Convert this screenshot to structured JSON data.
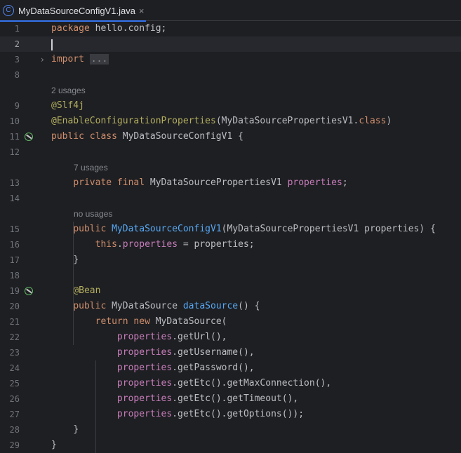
{
  "tab": {
    "title": "MyDataSourceConfigV1.java",
    "icon": "class-c-icon",
    "close": "×"
  },
  "lines": [
    {
      "n": "1",
      "tokens": [
        {
          "t": "kw",
          "v": "package"
        },
        {
          "t": "p",
          "v": " hello.config;"
        }
      ]
    },
    {
      "n": "2",
      "tokens": [],
      "current": true
    },
    {
      "n": "3",
      "tokens": [
        {
          "t": "kw",
          "v": "import"
        },
        {
          "t": "p",
          "v": " "
        },
        {
          "t": "fold",
          "v": "..."
        }
      ],
      "fold": true
    },
    {
      "n": "8",
      "tokens": []
    },
    {
      "hint": "2 usages"
    },
    {
      "n": "9",
      "tokens": [
        {
          "t": "ann",
          "v": "@Slf4j"
        }
      ]
    },
    {
      "n": "10",
      "tokens": [
        {
          "t": "ann",
          "v": "@EnableConfigurationProperties"
        },
        {
          "t": "p",
          "v": "(MyDataSourcePropertiesV1."
        },
        {
          "t": "kw",
          "v": "class"
        },
        {
          "t": "p",
          "v": ")"
        }
      ]
    },
    {
      "n": "11",
      "tokens": [
        {
          "t": "kw",
          "v": "public class"
        },
        {
          "t": "p",
          "v": " MyDataSourceConfigV1 {"
        }
      ],
      "gutter": "bean-icon"
    },
    {
      "n": "12",
      "tokens": []
    },
    {
      "hint": "7 usages",
      "indent": 1
    },
    {
      "n": "13",
      "tokens": [
        {
          "t": "i",
          "v": "    "
        },
        {
          "t": "kw",
          "v": "private final"
        },
        {
          "t": "p",
          "v": " MyDataSourcePropertiesV1 "
        },
        {
          "t": "fld",
          "v": "properties"
        },
        {
          "t": "p",
          "v": ";"
        }
      ]
    },
    {
      "n": "14",
      "tokens": []
    },
    {
      "hint": "no usages",
      "indent": 1
    },
    {
      "n": "15",
      "tokens": [
        {
          "t": "i",
          "v": "    "
        },
        {
          "t": "kw",
          "v": "public"
        },
        {
          "t": "p",
          "v": " "
        },
        {
          "t": "fn",
          "v": "MyDataSourceConfigV1"
        },
        {
          "t": "p",
          "v": "(MyDataSourcePropertiesV1 properties) {"
        }
      ]
    },
    {
      "n": "16",
      "tokens": [
        {
          "t": "i",
          "v": "        "
        },
        {
          "t": "kw",
          "v": "this"
        },
        {
          "t": "p",
          "v": "."
        },
        {
          "t": "fld",
          "v": "properties"
        },
        {
          "t": "p",
          "v": " = properties;"
        }
      ]
    },
    {
      "n": "17",
      "tokens": [
        {
          "t": "i",
          "v": "    "
        },
        {
          "t": "p",
          "v": "}"
        }
      ]
    },
    {
      "n": "18",
      "tokens": []
    },
    {
      "n": "19",
      "tokens": [
        {
          "t": "i",
          "v": "    "
        },
        {
          "t": "ann",
          "v": "@Bean"
        }
      ],
      "gutter": "bean-method-icon"
    },
    {
      "n": "20",
      "tokens": [
        {
          "t": "i",
          "v": "    "
        },
        {
          "t": "kw",
          "v": "public"
        },
        {
          "t": "p",
          "v": " MyDataSource "
        },
        {
          "t": "fn",
          "v": "dataSource"
        },
        {
          "t": "p",
          "v": "() {"
        }
      ]
    },
    {
      "n": "21",
      "tokens": [
        {
          "t": "i",
          "v": "        "
        },
        {
          "t": "kw",
          "v": "return new"
        },
        {
          "t": "p",
          "v": " MyDataSource("
        }
      ]
    },
    {
      "n": "22",
      "tokens": [
        {
          "t": "i",
          "v": "            "
        },
        {
          "t": "fld",
          "v": "properties"
        },
        {
          "t": "p",
          "v": ".getUrl(),"
        }
      ]
    },
    {
      "n": "23",
      "tokens": [
        {
          "t": "i",
          "v": "            "
        },
        {
          "t": "fld",
          "v": "properties"
        },
        {
          "t": "p",
          "v": ".getUsername(),"
        }
      ]
    },
    {
      "n": "24",
      "tokens": [
        {
          "t": "i",
          "v": "            "
        },
        {
          "t": "fld",
          "v": "properties"
        },
        {
          "t": "p",
          "v": ".getPassword(),"
        }
      ]
    },
    {
      "n": "25",
      "tokens": [
        {
          "t": "i",
          "v": "            "
        },
        {
          "t": "fld",
          "v": "properties"
        },
        {
          "t": "p",
          "v": ".getEtc().getMaxConnection(),"
        }
      ]
    },
    {
      "n": "26",
      "tokens": [
        {
          "t": "i",
          "v": "            "
        },
        {
          "t": "fld",
          "v": "properties"
        },
        {
          "t": "p",
          "v": ".getEtc().getTimeout(),"
        }
      ]
    },
    {
      "n": "27",
      "tokens": [
        {
          "t": "i",
          "v": "            "
        },
        {
          "t": "fld",
          "v": "properties"
        },
        {
          "t": "p",
          "v": ".getEtc().getOptions());"
        }
      ]
    },
    {
      "n": "28",
      "tokens": [
        {
          "t": "i",
          "v": "    "
        },
        {
          "t": "p",
          "v": "}"
        }
      ]
    },
    {
      "n": "29",
      "tokens": [
        {
          "t": "p",
          "v": "}"
        }
      ]
    }
  ]
}
